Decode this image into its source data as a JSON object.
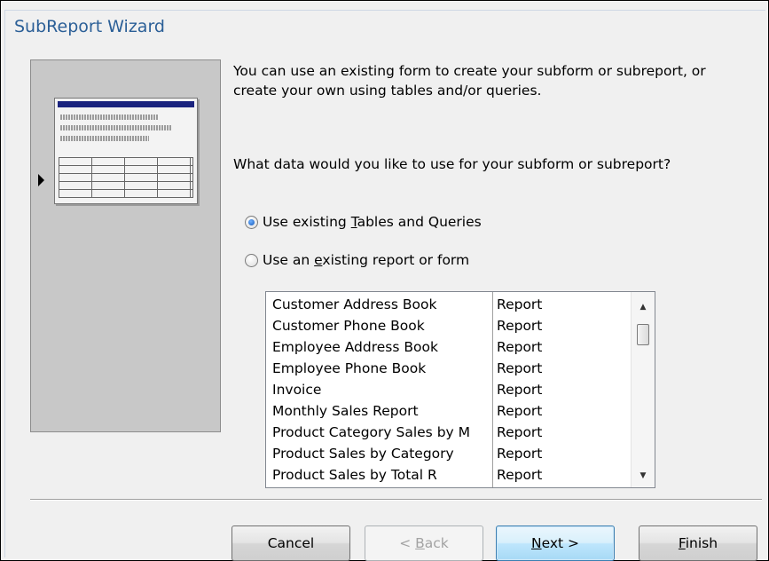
{
  "window": {
    "title": "SubReport Wizard"
  },
  "intro_text": "You can use an existing form to create your subform or subreport, or create your own using tables and/or queries.",
  "question_text": "What data would you like to use for your subform or subreport?",
  "options": [
    {
      "pre": "Use existing ",
      "accel": "T",
      "post": "ables and Queries",
      "selected": true
    },
    {
      "pre": "Use an ",
      "accel": "e",
      "post": "xisting report or form",
      "selected": false
    }
  ],
  "list": {
    "items": [
      {
        "name": "Customer Address Book",
        "type": "Report"
      },
      {
        "name": "Customer Phone Book",
        "type": "Report"
      },
      {
        "name": "Employee Address Book",
        "type": "Report"
      },
      {
        "name": "Employee Phone Book",
        "type": "Report"
      },
      {
        "name": "Invoice",
        "type": "Report"
      },
      {
        "name": "Monthly Sales Report",
        "type": "Report"
      },
      {
        "name": "Product Category Sales by M",
        "type": "Report"
      },
      {
        "name": "Product Sales by Category",
        "type": "Report"
      },
      {
        "name": "Product Sales by Total R",
        "type": "Report"
      }
    ]
  },
  "buttons": {
    "cancel": {
      "label": "Cancel"
    },
    "back": {
      "pre": "< ",
      "accel": "B",
      "post": "ack"
    },
    "next": {
      "accel": "N",
      "post": "ext >"
    },
    "finish": {
      "accel": "F",
      "post": "inish"
    }
  },
  "colors": {
    "title_text": "#2b5f97",
    "illustration_bar": "#1a237e"
  }
}
